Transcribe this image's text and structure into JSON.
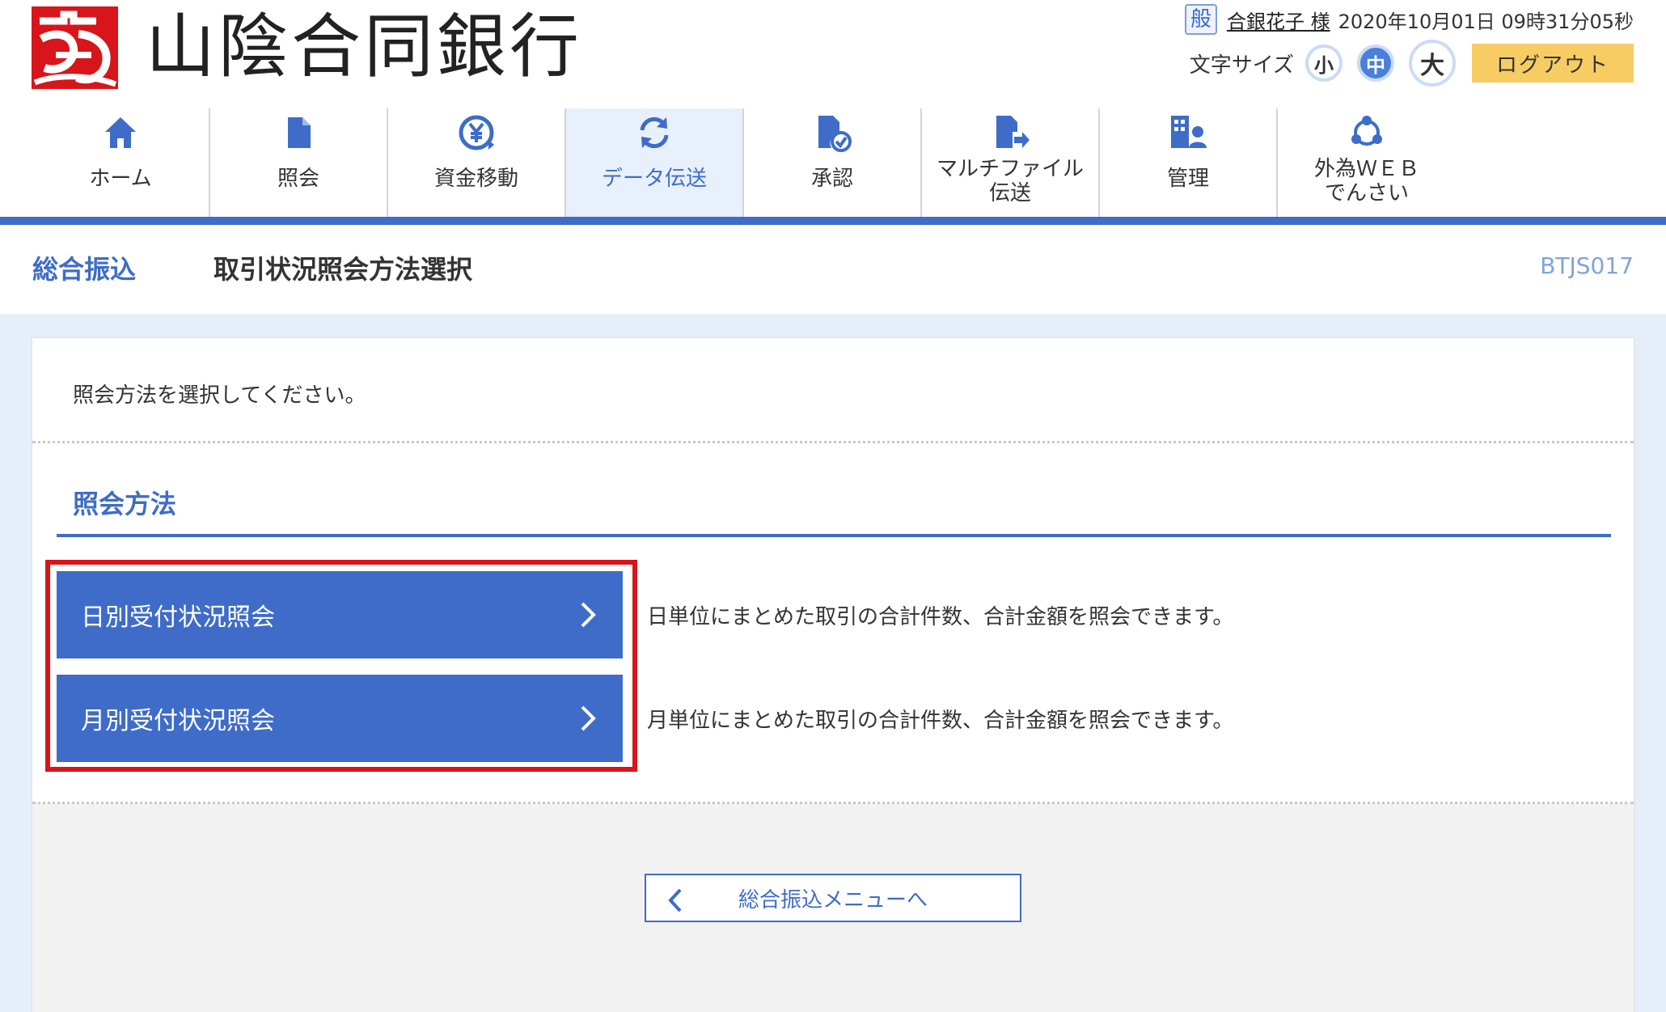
{
  "header": {
    "logo_text": "山陰合同銀行",
    "user_badge": "般",
    "user_name": "合銀花子 様",
    "datetime": "2020年10月01日 09時31分05秒",
    "font_size_label": "文字サイズ",
    "font_sizes": [
      "小",
      "中",
      "大"
    ],
    "font_size_selected": "中",
    "logout_label": "ログアウト"
  },
  "nav": {
    "items": [
      {
        "label": "ホーム",
        "icon": "home-icon"
      },
      {
        "label": "照会",
        "icon": "document-icon"
      },
      {
        "label": "資金移動",
        "icon": "yen-transfer-icon"
      },
      {
        "label": "データ伝送",
        "icon": "sync-icon",
        "active": true
      },
      {
        "label": "承認",
        "icon": "approve-document-icon"
      },
      {
        "label_line1": "マルチファイル",
        "label_line2": "伝送",
        "icon": "file-transfer-icon"
      },
      {
        "label": "管理",
        "icon": "admin-icon"
      },
      {
        "label_line1": "外為ＷＥＢ",
        "label_line2": "でんさい",
        "icon": "cycle-icon"
      }
    ]
  },
  "title": {
    "category": "総合振込",
    "main": "取引状況照会方法選択",
    "screen_code": "BTJS017"
  },
  "content": {
    "intro": "照会方法を選択してください。",
    "section_title": "照会方法",
    "options": [
      {
        "label": "日別受付状況照会",
        "description": "日単位にまとめた取引の合計件数、合計金額を照会できます。"
      },
      {
        "label": "月別受付状況照会",
        "description": "月単位にまとめた取引の合計件数、合計金額を照会できます。"
      }
    ],
    "back_label": "総合振込メニューへ"
  },
  "colors": {
    "primary": "#3e6cc8",
    "logout": "#f7cc63",
    "highlight": "#d7151a",
    "logo_red": "#d7151a"
  }
}
